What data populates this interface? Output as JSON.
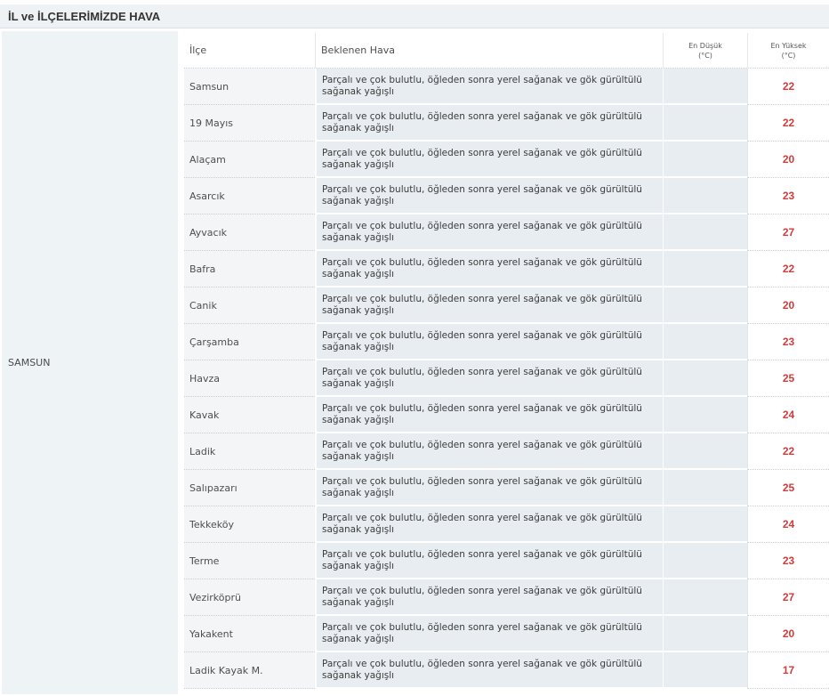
{
  "header": {
    "title": "İL ve İLÇELERİMİZDE HAVA"
  },
  "province": "SAMSUN",
  "columns": {
    "district": "İlçe",
    "weather": "Beklenen Hava",
    "min_line1": "En Düşük",
    "min_line2": "(°C)",
    "max_line1": "En Yüksek",
    "max_line2": "(°C)"
  },
  "rows": [
    {
      "district": "Samsun",
      "weather": "Parçalı ve çok bulutlu, öğleden sonra yerel sağanak ve gök gürültülü sağanak yağışlı",
      "min": "",
      "max": "22"
    },
    {
      "district": "19 Mayıs",
      "weather": "Parçalı ve çok bulutlu, öğleden sonra yerel sağanak ve gök gürültülü sağanak yağışlı",
      "min": "",
      "max": "22"
    },
    {
      "district": "Alaçam",
      "weather": "Parçalı ve çok bulutlu, öğleden sonra yerel sağanak ve gök gürültülü sağanak yağışlı",
      "min": "",
      "max": "20"
    },
    {
      "district": "Asarcık",
      "weather": "Parçalı ve çok bulutlu, öğleden sonra yerel sağanak ve gök gürültülü sağanak yağışlı",
      "min": "",
      "max": "23"
    },
    {
      "district": "Ayvacık",
      "weather": "Parçalı ve çok bulutlu, öğleden sonra yerel sağanak ve gök gürültülü sağanak yağışlı",
      "min": "",
      "max": "27"
    },
    {
      "district": "Bafra",
      "weather": "Parçalı ve çok bulutlu, öğleden sonra yerel sağanak ve gök gürültülü sağanak yağışlı",
      "min": "",
      "max": "22"
    },
    {
      "district": "Canik",
      "weather": "Parçalı ve çok bulutlu, öğleden sonra yerel sağanak ve gök gürültülü sağanak yağışlı",
      "min": "",
      "max": "20"
    },
    {
      "district": "Çarşamba",
      "weather": "Parçalı ve çok bulutlu, öğleden sonra yerel sağanak ve gök gürültülü sağanak yağışlı",
      "min": "",
      "max": "23"
    },
    {
      "district": "Havza",
      "weather": "Parçalı ve çok bulutlu, öğleden sonra yerel sağanak ve gök gürültülü sağanak yağışlı",
      "min": "",
      "max": "25"
    },
    {
      "district": "Kavak",
      "weather": "Parçalı ve çok bulutlu, öğleden sonra yerel sağanak ve gök gürültülü sağanak yağışlı",
      "min": "",
      "max": "24"
    },
    {
      "district": "Ladik",
      "weather": "Parçalı ve çok bulutlu, öğleden sonra yerel sağanak ve gök gürültülü sağanak yağışlı",
      "min": "",
      "max": "22"
    },
    {
      "district": "Salıpazarı",
      "weather": "Parçalı ve çok bulutlu, öğleden sonra yerel sağanak ve gök gürültülü sağanak yağışlı",
      "min": "",
      "max": "25"
    },
    {
      "district": "Tekkeköy",
      "weather": "Parçalı ve çok bulutlu, öğleden sonra yerel sağanak ve gök gürültülü sağanak yağışlı",
      "min": "",
      "max": "24"
    },
    {
      "district": "Terme",
      "weather": "Parçalı ve çok bulutlu, öğleden sonra yerel sağanak ve gök gürültülü sağanak yağışlı",
      "min": "",
      "max": "23"
    },
    {
      "district": "Vezirköprü",
      "weather": "Parçalı ve çok bulutlu, öğleden sonra yerel sağanak ve gök gürültülü sağanak yağışlı",
      "min": "",
      "max": "27"
    },
    {
      "district": "Yakakent",
      "weather": "Parçalı ve çok bulutlu, öğleden sonra yerel sağanak ve gök gürültülü sağanak yağışlı",
      "min": "",
      "max": "20"
    },
    {
      "district": "Ladik Kayak M.",
      "weather": "Parçalı ve çok bulutlu, öğleden sonra yerel sağanak ve gök gürültülü sağanak yağışlı",
      "min": "",
      "max": "17"
    }
  ],
  "colors": {
    "max_temp": "#d43b3b",
    "header_bg": "#eef2f5",
    "cell_bg": "#e7edf1"
  }
}
